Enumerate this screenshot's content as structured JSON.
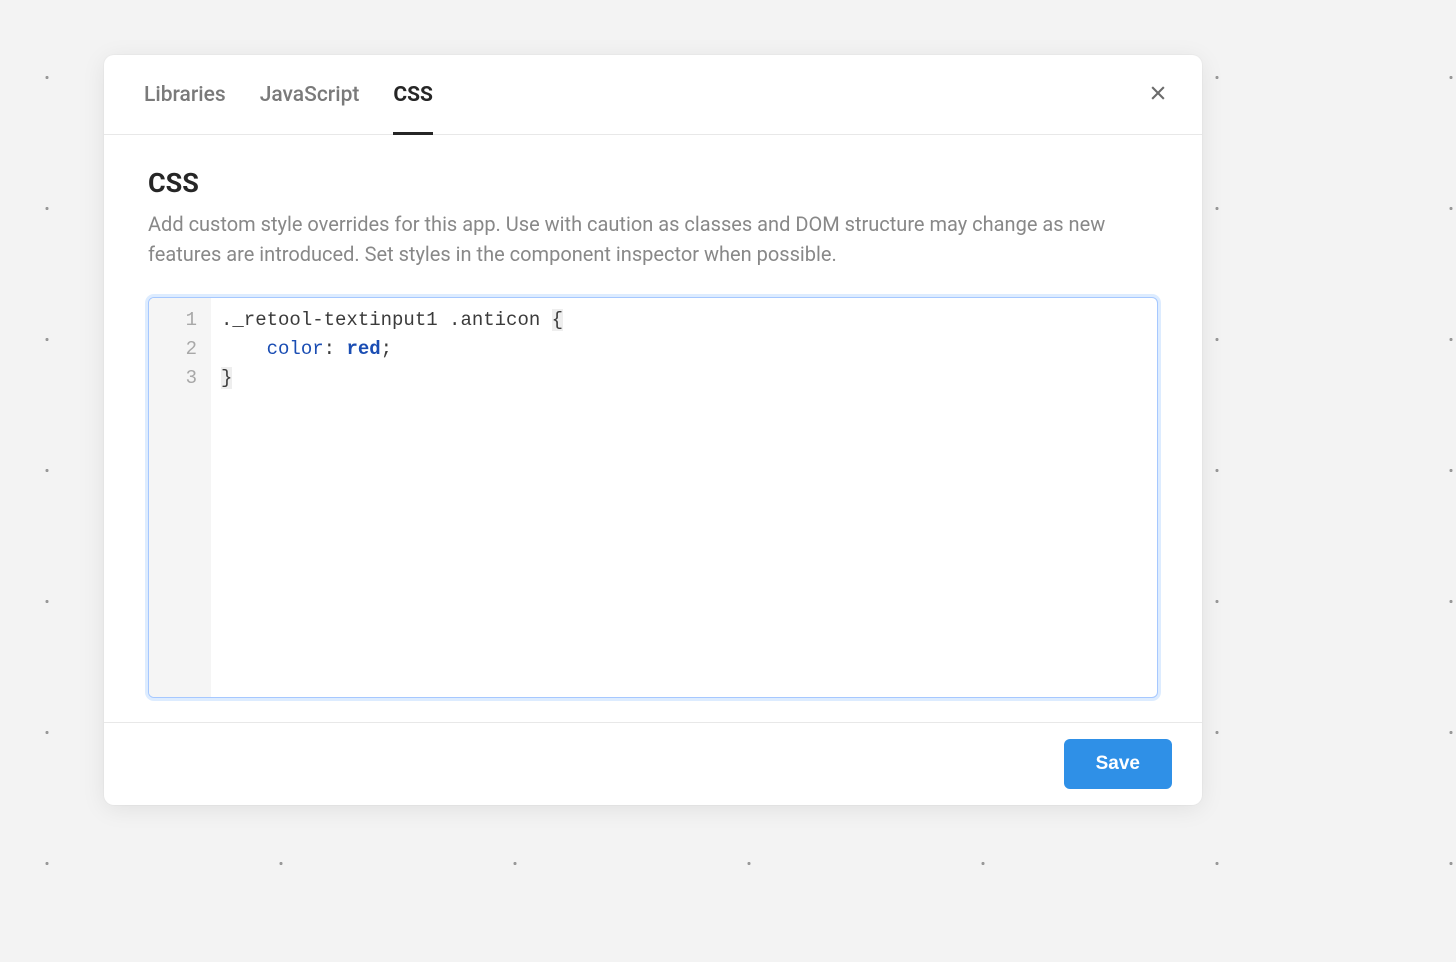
{
  "tabs": [
    {
      "label": "Libraries"
    },
    {
      "label": "JavaScript"
    },
    {
      "label": "CSS"
    }
  ],
  "active_tab_index": 2,
  "section": {
    "title": "CSS",
    "description": "Add custom style overrides for this app. Use with caution as classes and DOM structure may change as new features are introduced. Set styles in the component inspector when possible."
  },
  "editor": {
    "line_numbers": [
      "1",
      "2",
      "3"
    ],
    "lines": [
      {
        "selector": "._retool-textinput1 .anticon",
        "open_brace": "{"
      },
      {
        "indent": "    ",
        "prop": "color",
        "colon": ":",
        "space": " ",
        "value": "red",
        "semi": ";"
      },
      {
        "close_brace": "}"
      }
    ]
  },
  "footer": {
    "save_label": "Save"
  }
}
